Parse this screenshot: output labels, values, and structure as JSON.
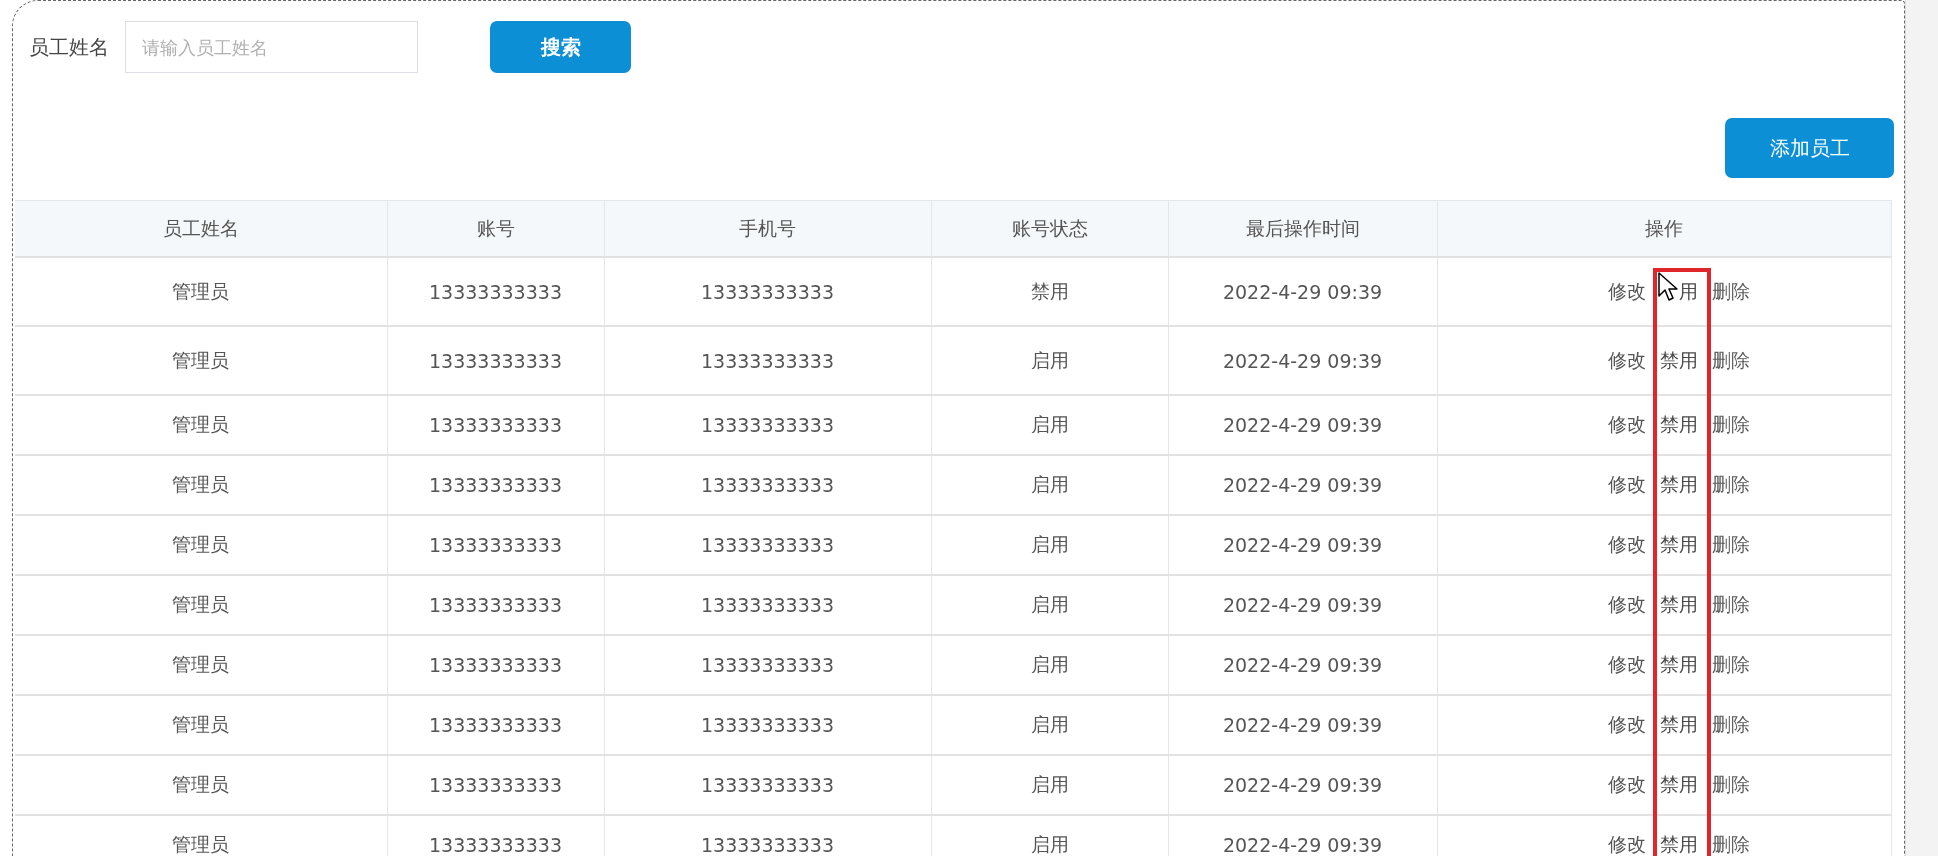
{
  "search": {
    "label": "员工姓名",
    "placeholder": "请输入员工姓名",
    "button": "搜索"
  },
  "add_button": "添加员工",
  "table": {
    "columns": [
      "员工姓名",
      "账号",
      "手机号",
      "账号状态",
      "最后操作时间",
      "操作"
    ],
    "rows": [
      {
        "name": "管理员",
        "account": "13333333333",
        "phone": "13333333333",
        "status": "禁用",
        "time": "2022-4-29 09:39",
        "actions": [
          {
            "kind": "edit",
            "label": "修改"
          },
          {
            "kind": "toggle",
            "label": "用"
          },
          {
            "kind": "delete",
            "label": "删除"
          }
        ]
      },
      {
        "name": "管理员",
        "account": "13333333333",
        "phone": "13333333333",
        "status": "启用",
        "time": "2022-4-29 09:39",
        "actions": [
          {
            "kind": "edit",
            "label": "修改"
          },
          {
            "kind": "toggle",
            "label": "禁用"
          },
          {
            "kind": "delete",
            "label": "删除"
          }
        ]
      },
      {
        "name": "管理员",
        "account": "13333333333",
        "phone": "13333333333",
        "status": "启用",
        "time": "2022-4-29 09:39",
        "actions": [
          {
            "kind": "edit",
            "label": "修改"
          },
          {
            "kind": "toggle",
            "label": "禁用"
          },
          {
            "kind": "delete",
            "label": "删除"
          }
        ]
      },
      {
        "name": "管理员",
        "account": "13333333333",
        "phone": "13333333333",
        "status": "启用",
        "time": "2022-4-29 09:39",
        "actions": [
          {
            "kind": "edit",
            "label": "修改"
          },
          {
            "kind": "toggle",
            "label": "禁用"
          },
          {
            "kind": "delete",
            "label": "删除"
          }
        ]
      },
      {
        "name": "管理员",
        "account": "13333333333",
        "phone": "13333333333",
        "status": "启用",
        "time": "2022-4-29 09:39",
        "actions": [
          {
            "kind": "edit",
            "label": "修改"
          },
          {
            "kind": "toggle",
            "label": "禁用"
          },
          {
            "kind": "delete",
            "label": "删除"
          }
        ]
      },
      {
        "name": "管理员",
        "account": "13333333333",
        "phone": "13333333333",
        "status": "启用",
        "time": "2022-4-29 09:39",
        "actions": [
          {
            "kind": "edit",
            "label": "修改"
          },
          {
            "kind": "toggle",
            "label": "禁用"
          },
          {
            "kind": "delete",
            "label": "删除"
          }
        ]
      },
      {
        "name": "管理员",
        "account": "13333333333",
        "phone": "13333333333",
        "status": "启用",
        "time": "2022-4-29 09:39",
        "actions": [
          {
            "kind": "edit",
            "label": "修改"
          },
          {
            "kind": "toggle",
            "label": "禁用"
          },
          {
            "kind": "delete",
            "label": "删除"
          }
        ]
      },
      {
        "name": "管理员",
        "account": "13333333333",
        "phone": "13333333333",
        "status": "启用",
        "time": "2022-4-29 09:39",
        "actions": [
          {
            "kind": "edit",
            "label": "修改"
          },
          {
            "kind": "toggle",
            "label": "禁用"
          },
          {
            "kind": "delete",
            "label": "删除"
          }
        ]
      },
      {
        "name": "管理员",
        "account": "13333333333",
        "phone": "13333333333",
        "status": "启用",
        "time": "2022-4-29 09:39",
        "actions": [
          {
            "kind": "edit",
            "label": "修改"
          },
          {
            "kind": "toggle",
            "label": "禁用"
          },
          {
            "kind": "delete",
            "label": "删除"
          }
        ]
      },
      {
        "name": "管理员",
        "account": "13333333333",
        "phone": "13333333333",
        "status": "启用",
        "time": "2022-4-29 09:39",
        "actions": [
          {
            "kind": "edit",
            "label": "修改"
          },
          {
            "kind": "toggle",
            "label": "禁用"
          },
          {
            "kind": "delete",
            "label": "删除"
          }
        ]
      }
    ],
    "highlight_box": {
      "visible": true
    },
    "cursor": {
      "visible": true
    }
  }
}
